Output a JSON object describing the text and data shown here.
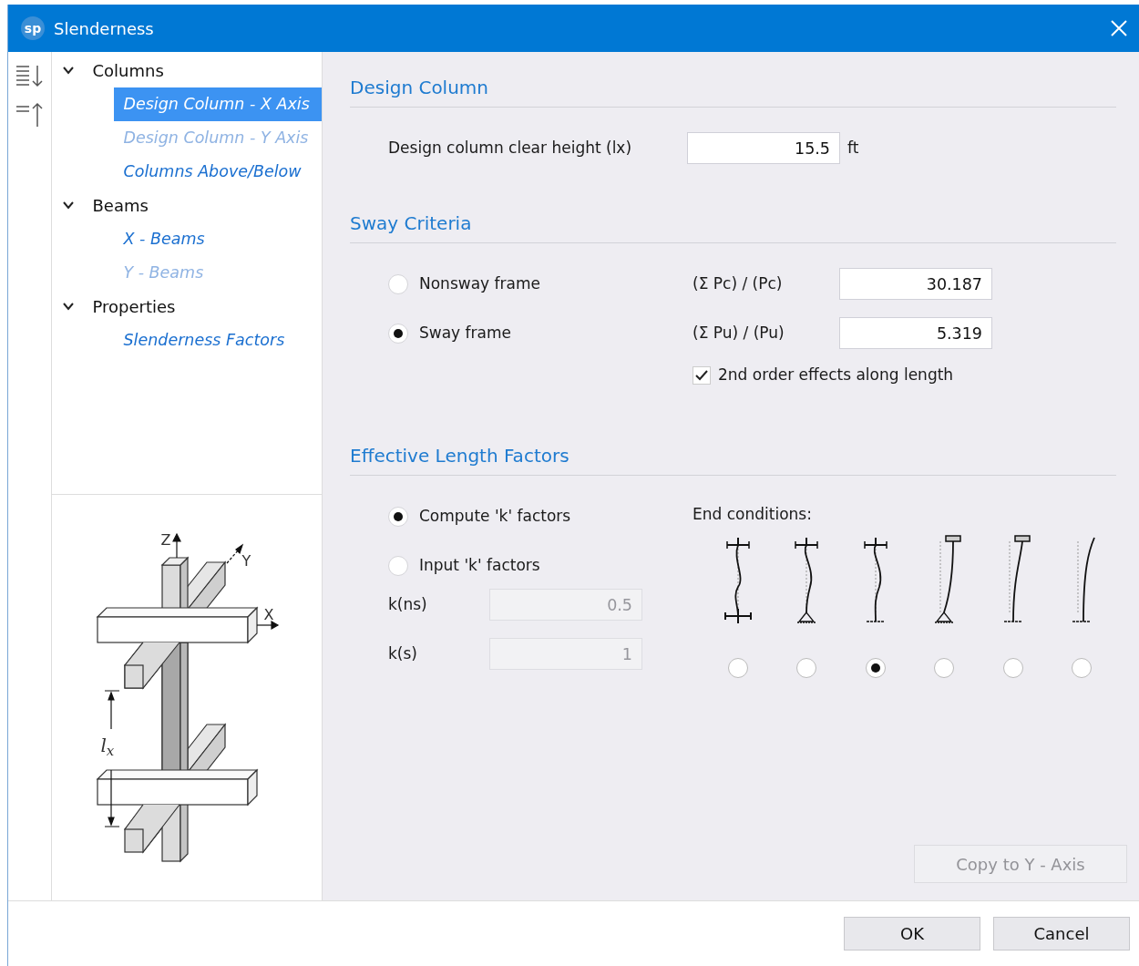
{
  "window": {
    "logo": "sp",
    "title": "Slenderness"
  },
  "tree": [
    {
      "label": "Columns",
      "expanded": true,
      "children": [
        {
          "label": "Design Column - X Axis",
          "selected": true,
          "disabled": false
        },
        {
          "label": "Design Column - Y Axis",
          "selected": false,
          "disabled": true
        },
        {
          "label": "Columns Above/Below",
          "selected": false,
          "disabled": false
        }
      ]
    },
    {
      "label": "Beams",
      "expanded": true,
      "children": [
        {
          "label": "X - Beams",
          "selected": false,
          "disabled": false
        },
        {
          "label": "Y - Beams",
          "selected": false,
          "disabled": true
        }
      ]
    },
    {
      "label": "Properties",
      "expanded": true,
      "children": [
        {
          "label": "Slenderness Factors",
          "selected": false,
          "disabled": false
        }
      ]
    }
  ],
  "diagram": {
    "z_label": "Z",
    "y_label": "Y",
    "x_label": "X",
    "length_label": "l$_{x}$"
  },
  "design_column": {
    "title": "Design Column",
    "label": "Design column clear height (lx)",
    "value": "15.5",
    "unit": "ft"
  },
  "sway_criteria": {
    "title": "Sway Criteria",
    "options": [
      {
        "label": "Nonsway frame",
        "selected": false
      },
      {
        "label": "Sway frame",
        "selected": true
      }
    ],
    "ratios": [
      {
        "label": "(Σ Pc) / (Pc)",
        "value": "30.187"
      },
      {
        "label": "(Σ Pu) / (Pu)",
        "value": "5.319"
      }
    ],
    "second_order": {
      "label": "2nd order effects along length",
      "checked": true
    }
  },
  "effective_length": {
    "title": "Effective Length Factors",
    "options": [
      {
        "label": "Compute 'k' factors",
        "selected": true
      },
      {
        "label": "Input 'k' factors",
        "selected": false
      }
    ],
    "k_fields": [
      {
        "label": "k(ns)",
        "value": "0.5",
        "disabled": true
      },
      {
        "label": "k(s)",
        "value": "1",
        "disabled": true
      }
    ],
    "end_conditions_label": "End conditions:",
    "end_conditions": [
      {
        "kind": "cross-cross",
        "selected": false
      },
      {
        "kind": "cross-pin",
        "selected": false
      },
      {
        "kind": "cross-fixed",
        "selected": true
      },
      {
        "kind": "block-pin",
        "selected": false
      },
      {
        "kind": "block-fixed",
        "selected": false
      },
      {
        "kind": "free-fixed",
        "selected": false
      }
    ]
  },
  "copy_button": {
    "label": "Copy to Y - Axis",
    "disabled": true
  },
  "buttons": [
    "OK",
    "Cancel"
  ]
}
